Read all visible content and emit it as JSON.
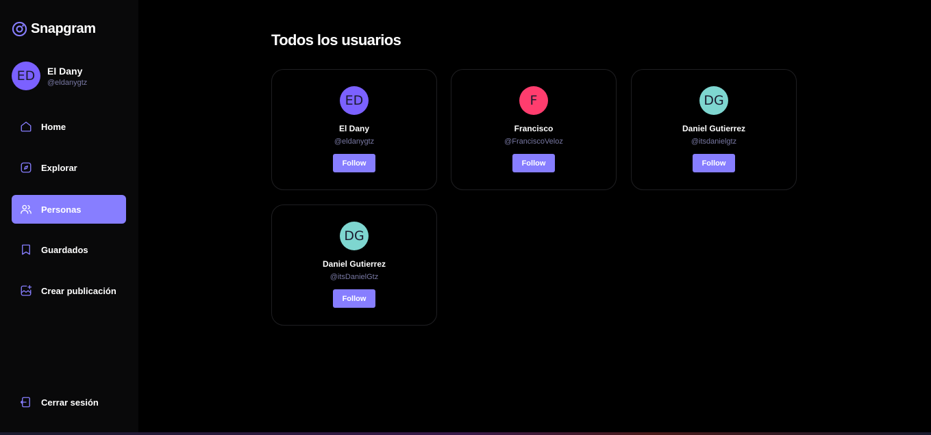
{
  "app": {
    "name": "Snapgram"
  },
  "profile": {
    "initials": "ED",
    "name": "El Dany",
    "handle": "@eldanygtz",
    "avatar_color": "#7b61ff"
  },
  "sidebar": {
    "items": [
      {
        "label": "Home",
        "icon": "home-icon",
        "active": false
      },
      {
        "label": "Explorar",
        "icon": "explore-icon",
        "active": false
      },
      {
        "label": "Personas",
        "icon": "people-icon",
        "active": true
      },
      {
        "label": "Guardados",
        "icon": "bookmark-icon",
        "active": false
      },
      {
        "label": "Crear publicación",
        "icon": "create-post-icon",
        "active": false
      }
    ],
    "logout": {
      "label": "Cerrar sesión",
      "icon": "logout-icon"
    }
  },
  "main": {
    "title": "Todos los usuarios",
    "users": [
      {
        "initials": "ED",
        "name": "El Dany",
        "handle": "@eldanygtz",
        "avatar_color": "#7b61ff",
        "follow_label": "Follow"
      },
      {
        "initials": "F",
        "name": "Francisco",
        "handle": "@FranciscoVeloz",
        "avatar_color": "#ff3d6e",
        "follow_label": "Follow"
      },
      {
        "initials": "DG",
        "name": "Daniel Gutierrez",
        "handle": "@itsdanielgtz",
        "avatar_color": "#7ed6d0",
        "follow_label": "Follow"
      },
      {
        "initials": "DG",
        "name": "Daniel Gutierrez",
        "handle": "@itsDanielGtz",
        "avatar_color": "#7ed6d0",
        "follow_label": "Follow"
      }
    ]
  },
  "colors": {
    "accent": "#877eff",
    "background": "#000000",
    "sidebar": "#09090a",
    "muted_text": "#7878a3"
  }
}
